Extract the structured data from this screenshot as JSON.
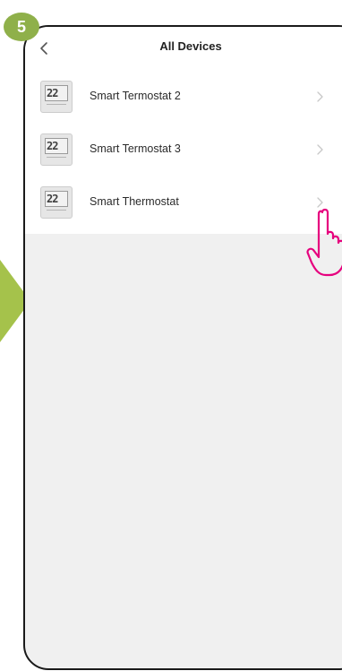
{
  "step": {
    "number": "5",
    "badge_color": "#8fb04a",
    "pointer_color": "#a5c24b"
  },
  "nav": {
    "title": "All Devices",
    "back_icon": "chevron-left-icon"
  },
  "devices": [
    {
      "name": "Smart Termostat 2",
      "display": "22",
      "icon": "thermostat-icon"
    },
    {
      "name": "Smart Termostat 3",
      "display": "22",
      "icon": "thermostat-icon"
    },
    {
      "name": "Smart Thermostat",
      "display": "22",
      "icon": "thermostat-icon"
    }
  ],
  "gesture": {
    "icon": "tap-hand-icon",
    "color": "#e6007e"
  }
}
